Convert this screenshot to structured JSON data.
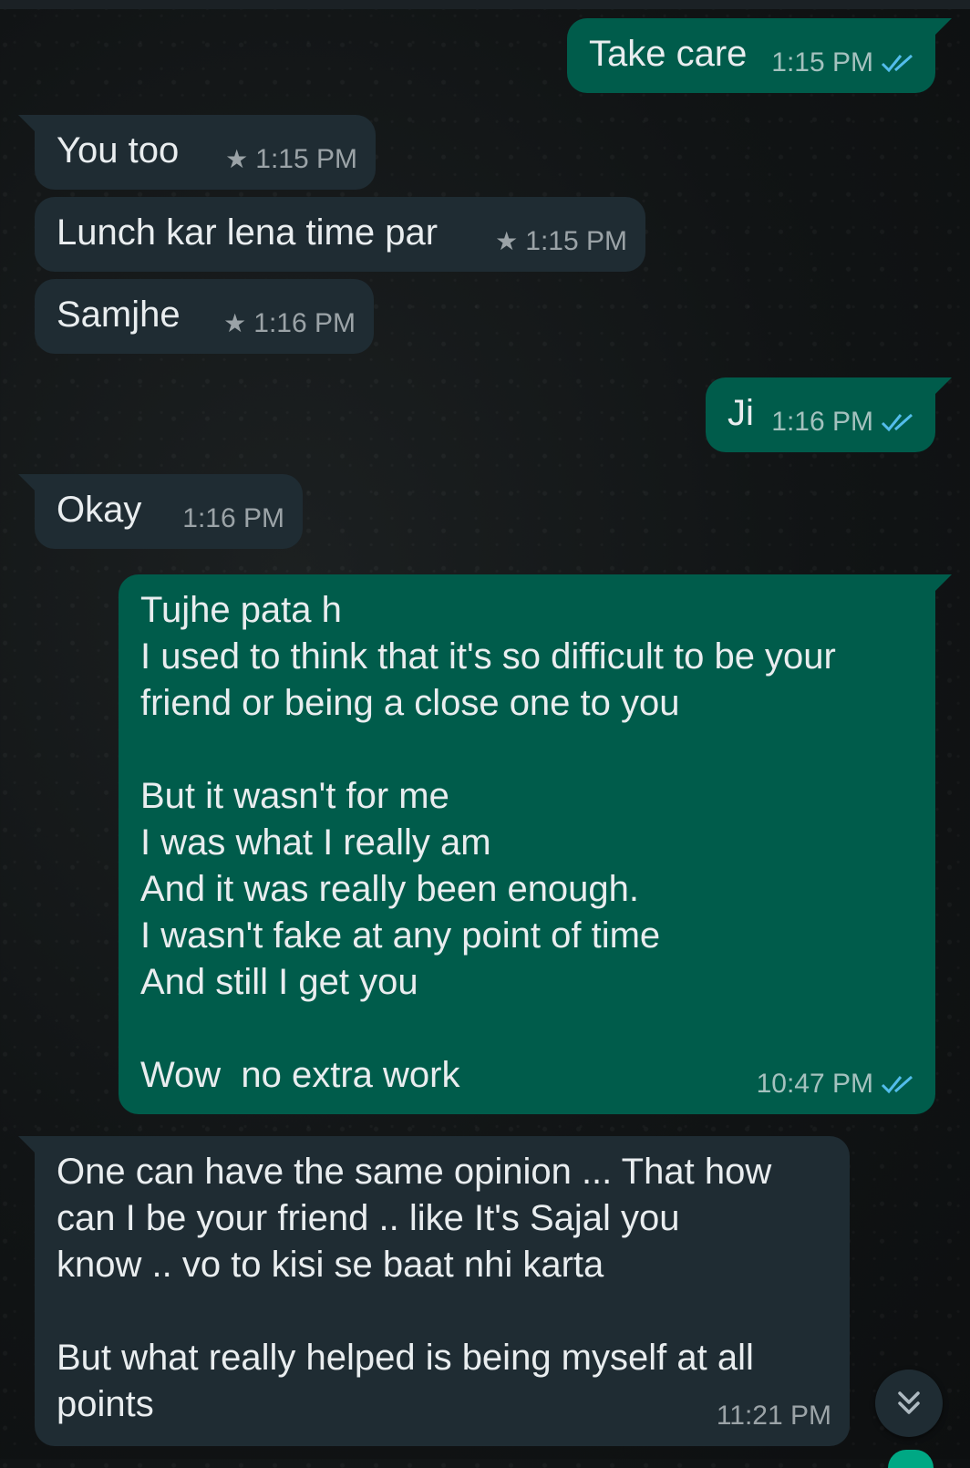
{
  "messages": [
    {
      "id": "m1",
      "direction": "out",
      "text": "Take care",
      "time": "1:15 PM",
      "starred": false,
      "ticks": "read"
    },
    {
      "id": "m2",
      "direction": "in",
      "text": "You too",
      "time": "1:15 PM",
      "starred": true
    },
    {
      "id": "m3",
      "direction": "in",
      "text": "Lunch kar lena time par",
      "time": "1:15 PM",
      "starred": true
    },
    {
      "id": "m4",
      "direction": "in",
      "text": "Samjhe",
      "time": "1:16 PM",
      "starred": true
    },
    {
      "id": "m5",
      "direction": "out",
      "text": "Ji",
      "time": "1:16 PM",
      "starred": false,
      "ticks": "read"
    },
    {
      "id": "m6",
      "direction": "in",
      "text": "Okay",
      "time": "1:16 PM",
      "starred": false
    },
    {
      "id": "m7",
      "direction": "out",
      "text": "Tujhe pata h\nI used to think that it's so difficult to be your\nfriend or being a close one to you\n\nBut it wasn't for me\nI was what I really am\nAnd it was really been enough.\nI wasn't fake at any point of time\nAnd still I get you\n\nWow  no extra work",
      "time": "10:47 PM",
      "starred": false,
      "ticks": "read"
    },
    {
      "id": "m8",
      "direction": "in",
      "text": "One can have the same opinion ... That how\ncan I be your friend .. like It's Sajal you\nknow .. vo to kisi se baat nhi karta\n\nBut what really helped is being myself at all\npoints",
      "time": "11:21 PM",
      "starred": false
    }
  ],
  "icons": {
    "star": "star-icon",
    "read_ticks": "double-check-icon",
    "scroll_down": "chevron-double-down-icon"
  },
  "colors": {
    "incoming_bubble": "#1f2c33",
    "outgoing_bubble": "#005c4b",
    "read_tick": "#53bdeb",
    "background": "#111415"
  }
}
